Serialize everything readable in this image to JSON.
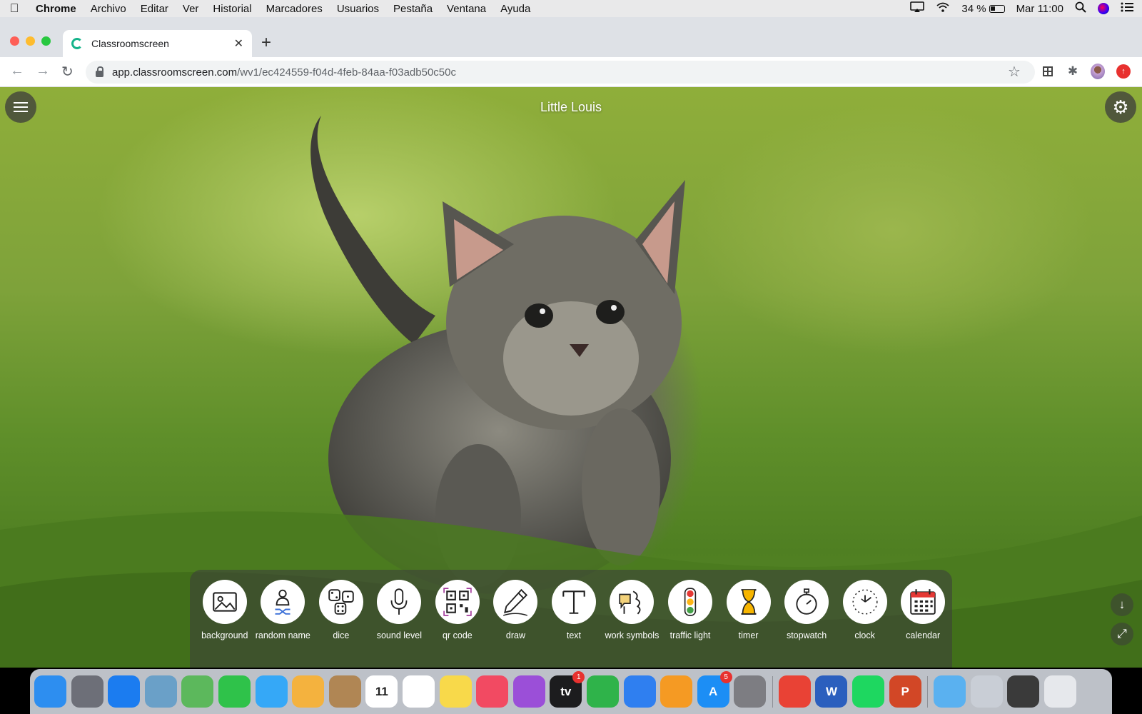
{
  "menubar": {
    "app_name": "Chrome",
    "items": [
      "Archivo",
      "Editar",
      "Ver",
      "Historial",
      "Marcadores",
      "Usuarios",
      "Pestaña",
      "Ventana",
      "Ayuda"
    ],
    "battery": "34 %",
    "clock": "Mar 11:00"
  },
  "browser": {
    "tab_title": "Classroomscreen",
    "url_host": "app.classroomscreen.com",
    "url_path": "/wv1/ec424559-f04d-4feb-84aa-f03adb50c50c"
  },
  "board": {
    "title": "Little Louis",
    "widgets": [
      {
        "id": "background",
        "label": "background",
        "icon": "image-icon"
      },
      {
        "id": "random-name",
        "label": "random name",
        "icon": "person-shuffle-icon"
      },
      {
        "id": "dice",
        "label": "dice",
        "icon": "dice-icon"
      },
      {
        "id": "sound-level",
        "label": "sound level",
        "icon": "microphone-icon"
      },
      {
        "id": "qr-code",
        "label": "qr code",
        "icon": "qr-code-icon"
      },
      {
        "id": "draw",
        "label": "draw",
        "icon": "pencil-icon"
      },
      {
        "id": "text",
        "label": "text",
        "icon": "text-icon"
      },
      {
        "id": "work-symbols",
        "label": "work symbols",
        "icon": "work-symbols-icon"
      },
      {
        "id": "traffic-light",
        "label": "traffic light",
        "icon": "traffic-light-icon"
      },
      {
        "id": "timer",
        "label": "timer",
        "icon": "hourglass-icon"
      },
      {
        "id": "stopwatch",
        "label": "stopwatch",
        "icon": "stopwatch-icon"
      },
      {
        "id": "clock",
        "label": "clock",
        "icon": "clock-icon"
      },
      {
        "id": "calendar",
        "label": "calendar",
        "icon": "calendar-icon"
      }
    ]
  },
  "dock": {
    "apps": [
      {
        "name": "finder-icon",
        "color": "#2d8ef0"
      },
      {
        "name": "launchpad-icon",
        "color": "#6d6f78"
      },
      {
        "name": "safari-icon",
        "color": "#1b7cf0"
      },
      {
        "name": "preview-icon",
        "color": "#6aa0c8"
      },
      {
        "name": "maps-icon",
        "color": "#5cb85c"
      },
      {
        "name": "facetime-icon",
        "color": "#2fc24a"
      },
      {
        "name": "messages-icon",
        "color": "#35a8f7"
      },
      {
        "name": "photos-icon",
        "color": "#f4b23e"
      },
      {
        "name": "contacts-icon",
        "color": "#b08654"
      },
      {
        "name": "calendar-app-icon",
        "color": "#ffffff",
        "text": "11",
        "text_color": "#222"
      },
      {
        "name": "reminders-icon",
        "color": "#ffffff"
      },
      {
        "name": "notes-icon",
        "color": "#f8d94a"
      },
      {
        "name": "music-icon",
        "color": "#f24a62"
      },
      {
        "name": "podcasts-icon",
        "color": "#9b4fd8"
      },
      {
        "name": "apple-tv-icon",
        "color": "#1c1c1e",
        "text": "tv",
        "badge": "1"
      },
      {
        "name": "numbers-icon",
        "color": "#2fb34a"
      },
      {
        "name": "keynote-icon",
        "color": "#2f7ff0"
      },
      {
        "name": "pages-icon",
        "color": "#f59a23"
      },
      {
        "name": "app-store-icon",
        "color": "#1c8ef5",
        "text": "A",
        "badge": "5"
      },
      {
        "name": "system-preferences-icon",
        "color": "#7d7d82"
      },
      {
        "name": "chrome-icon",
        "color": "#e94235"
      },
      {
        "name": "word-icon",
        "color": "#2b5fbe",
        "text": "W"
      },
      {
        "name": "spotify-icon",
        "color": "#1ed760"
      },
      {
        "name": "powerpoint-icon",
        "color": "#d24726",
        "text": "P"
      },
      {
        "name": "downloads-folder-icon",
        "color": "#5ab1f0"
      },
      {
        "name": "stack-icon",
        "color": "#c9ced6"
      },
      {
        "name": "stack-2-icon",
        "color": "#3a3a3a"
      },
      {
        "name": "trash-icon",
        "color": "#e6e8ec"
      }
    ]
  }
}
